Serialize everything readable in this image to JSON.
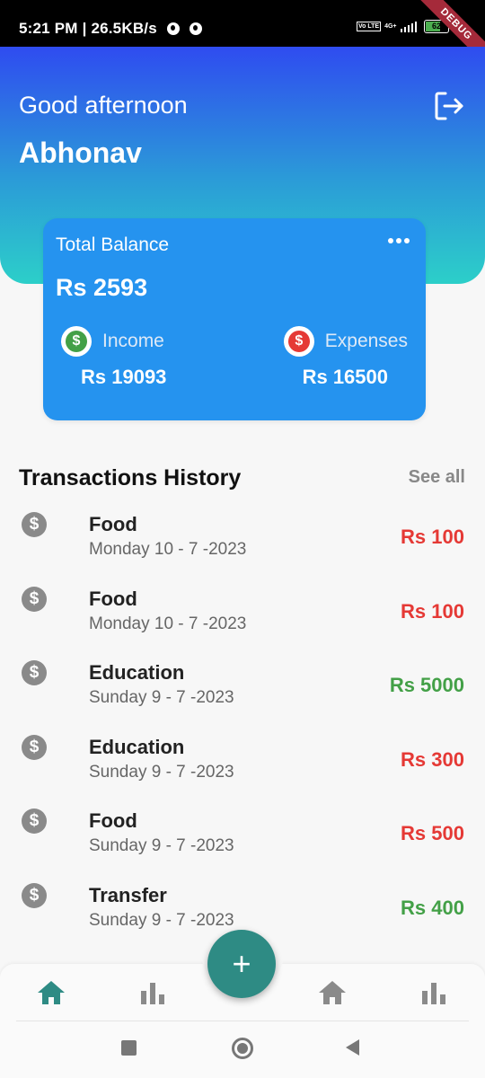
{
  "status_bar": {
    "time_speed": "5:21 PM | 26.5KB/s",
    "volte": "Vo LTE",
    "network": "4G+",
    "battery": "62",
    "debug_label": "DEBUG"
  },
  "header": {
    "greeting": "Good afternoon",
    "username": "Abhonav",
    "logout_icon": "logout-icon"
  },
  "balance": {
    "label": "Total Balance",
    "amount": "Rs 2593",
    "income_label": "Income",
    "income_amount": "Rs 19093",
    "expense_label": "Expenses",
    "expense_amount": "Rs 16500",
    "income_color": "#43a047",
    "expense_color": "#e53935"
  },
  "transactions": {
    "title": "Transactions History",
    "see_all": "See all",
    "items": [
      {
        "category": "Food",
        "date": "Monday 10 - 7 -2023",
        "amount": "Rs 100",
        "type": "expense"
      },
      {
        "category": "Food",
        "date": "Monday 10 - 7 -2023",
        "amount": "Rs 100",
        "type": "expense"
      },
      {
        "category": "Education",
        "date": "Sunday 9 - 7 -2023",
        "amount": "Rs 5000",
        "type": "income"
      },
      {
        "category": "Education",
        "date": "Sunday 9 - 7 -2023",
        "amount": "Rs 300",
        "type": "expense"
      },
      {
        "category": "Food",
        "date": "Sunday 9 - 7 -2023",
        "amount": "Rs 500",
        "type": "expense"
      },
      {
        "category": "Transfer",
        "date": "Sunday 9 - 7 -2023",
        "amount": "Rs 400",
        "type": "income"
      }
    ]
  },
  "bottom_nav": {
    "fab_label": "+",
    "accent": "#2e8b84",
    "inactive": "#8a8a8a"
  }
}
